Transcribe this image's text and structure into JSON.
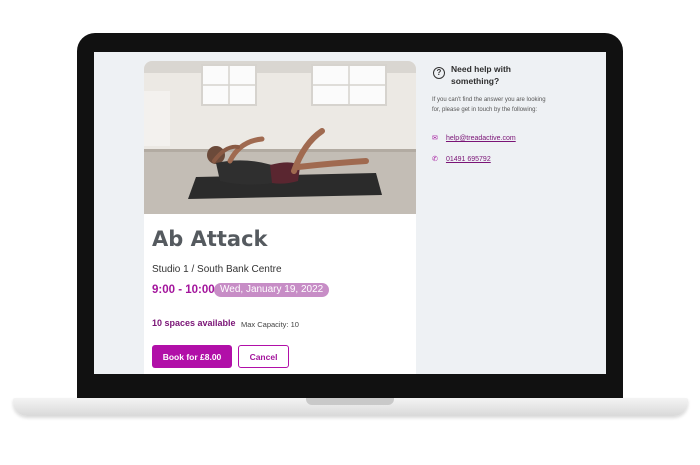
{
  "card": {
    "title": "Ab Attack",
    "location": "Studio 1 / South Bank Centre",
    "time": "9:00 - 10:00",
    "date": "Wed, January 19, 2022",
    "spaces_available": "10 spaces available",
    "max_capacity": "Max Capacity: 10",
    "book_label": "Book for £8.00",
    "cancel_label": "Cancel"
  },
  "help": {
    "title": "Need help with something?",
    "text": "If you can't find the answer you are looking for, please get in touch by the following:",
    "email": "help@treadactive.com",
    "phone": "01491 695792"
  },
  "icons": {
    "help": "question-circle-icon",
    "email": "envelope-icon",
    "phone": "phone-icon"
  },
  "colors": {
    "accent": "#b10fa8",
    "accent_dark": "#7a1476",
    "badge": "#c78dc6",
    "screen_bg": "#eef1f4"
  }
}
